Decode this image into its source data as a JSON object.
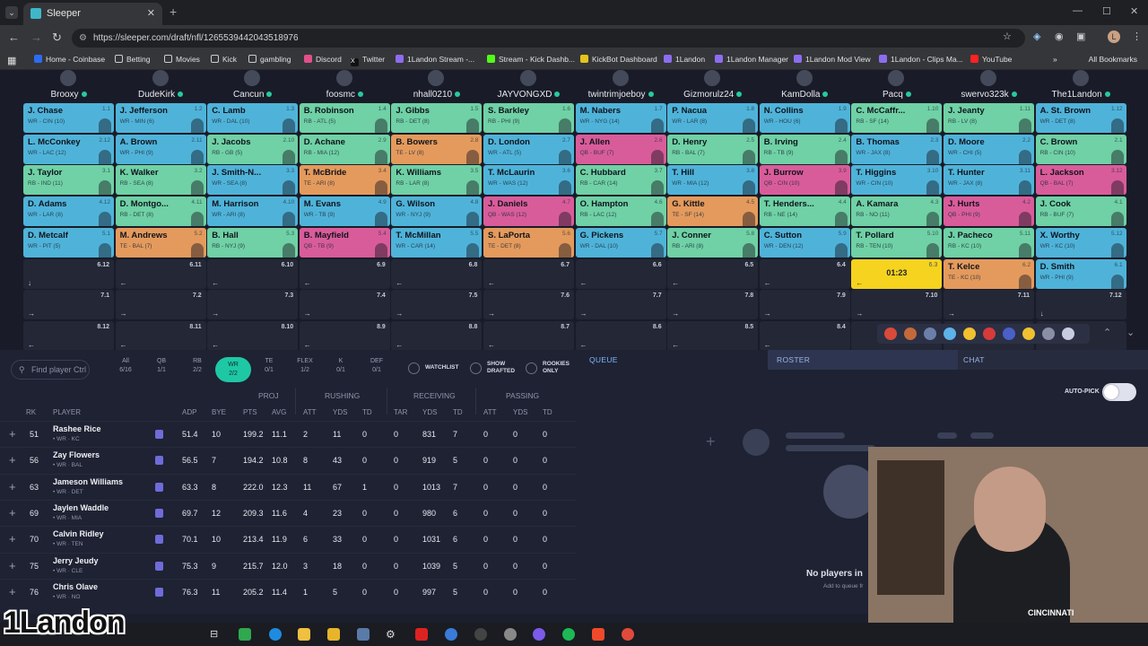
{
  "browser": {
    "tab_title": "Sleeper",
    "url": "https://sleeper.com/draft/nfl/1265539442043518976",
    "bookmarks": [
      "Home - Coinbase",
      "Betting",
      "Movies",
      "Kick",
      "gambling",
      "Discord",
      "Twitter",
      "1Landon Stream -...",
      "Stream - Kick Dashb...",
      "KickBot Dashboard",
      "1Landon",
      "1Landon Manager",
      "1Landon Mod View",
      "1Landon - Clips Ma...",
      "YouTube"
    ],
    "all_bookmarks": "All Bookmarks",
    "profile_initial": "L"
  },
  "teams": [
    "Brooxy",
    "DudeKirk",
    "Cancun",
    "foosmc",
    "nhall0210",
    "JAYVONGXD",
    "twintrimjoeboy",
    "Gizmorulz24",
    "KamDolla",
    "Pacq",
    "swervo323k",
    "The1Landon"
  ],
  "board": [
    [
      {
        "name": "J. Chase",
        "info": "WR - CIN (10)",
        "pick": "1.1",
        "pos": "WR"
      },
      {
        "name": "J. Jefferson",
        "info": "WR - MIN (6)",
        "pick": "1.2",
        "pos": "WR"
      },
      {
        "name": "C. Lamb",
        "info": "WR - DAL (10)",
        "pick": "1.3",
        "pos": "WR"
      },
      {
        "name": "B. Robinson",
        "info": "RB - ATL (5)",
        "pick": "1.4",
        "pos": "RB"
      },
      {
        "name": "J. Gibbs",
        "info": "RB - DET (8)",
        "pick": "1.5",
        "pos": "RB"
      },
      {
        "name": "S. Barkley",
        "info": "RB - PHI (9)",
        "pick": "1.6",
        "pos": "RB"
      },
      {
        "name": "M. Nabers",
        "info": "WR - NYG (14)",
        "pick": "1.7",
        "pos": "WR"
      },
      {
        "name": "P. Nacua",
        "info": "WR - LAR (8)",
        "pick": "1.8",
        "pos": "WR"
      },
      {
        "name": "N. Collins",
        "info": "WR - HOU (6)",
        "pick": "1.9",
        "pos": "WR"
      },
      {
        "name": "C. McCaffr...",
        "info": "RB - SF (14)",
        "pick": "1.10",
        "pos": "RB"
      },
      {
        "name": "J. Jeanty",
        "info": "RB - LV (8)",
        "pick": "1.11",
        "pos": "RB"
      },
      {
        "name": "A. St. Brown",
        "info": "WR - DET (8)",
        "pick": "1.12",
        "pos": "WR"
      }
    ],
    [
      {
        "name": "L. McConkey",
        "info": "WR - LAC (12)",
        "pick": "2.12",
        "pos": "WR"
      },
      {
        "name": "A. Brown",
        "info": "WR - PHI (9)",
        "pick": "2.11",
        "pos": "WR"
      },
      {
        "name": "J. Jacobs",
        "info": "RB - GB (5)",
        "pick": "2.10",
        "pos": "RB"
      },
      {
        "name": "D. Achane",
        "info": "RB - MIA (12)",
        "pick": "2.9",
        "pos": "RB"
      },
      {
        "name": "B. Bowers",
        "info": "TE - LV (8)",
        "pick": "2.8",
        "pos": "TE"
      },
      {
        "name": "D. London",
        "info": "WR - ATL (5)",
        "pick": "2.7",
        "pos": "WR"
      },
      {
        "name": "J. Allen",
        "info": "QB - BUF (7)",
        "pick": "2.6",
        "pos": "QB"
      },
      {
        "name": "D. Henry",
        "info": "RB - BAL (7)",
        "pick": "2.5",
        "pos": "RB"
      },
      {
        "name": "B. Irving",
        "info": "RB - TB (9)",
        "pick": "2.4",
        "pos": "RB"
      },
      {
        "name": "B. Thomas",
        "info": "WR - JAX (8)",
        "pick": "2.3",
        "pos": "WR"
      },
      {
        "name": "D. Moore",
        "info": "WR - CHI (5)",
        "pick": "2.2",
        "pos": "WR"
      },
      {
        "name": "C. Brown",
        "info": "RB - CIN (10)",
        "pick": "2.1",
        "pos": "RB"
      }
    ],
    [
      {
        "name": "J. Taylor",
        "info": "RB - IND (11)",
        "pick": "3.1",
        "pos": "RB"
      },
      {
        "name": "K. Walker",
        "info": "RB - SEA (8)",
        "pick": "3.2",
        "pos": "RB"
      },
      {
        "name": "J. Smith-N...",
        "info": "WR - SEA (8)",
        "pick": "3.3",
        "pos": "WR"
      },
      {
        "name": "T. McBride",
        "info": "TE - ARI (8)",
        "pick": "3.4",
        "pos": "TE"
      },
      {
        "name": "K. Williams",
        "info": "RB - LAR (8)",
        "pick": "3.5",
        "pos": "RB"
      },
      {
        "name": "T. McLaurin",
        "info": "WR - WAS (12)",
        "pick": "3.6",
        "pos": "WR"
      },
      {
        "name": "C. Hubbard",
        "info": "RB - CAR (14)",
        "pick": "3.7",
        "pos": "RB"
      },
      {
        "name": "T. Hill",
        "info": "WR - MIA (12)",
        "pick": "3.8",
        "pos": "WR"
      },
      {
        "name": "J. Burrow",
        "info": "QB - CIN (10)",
        "pick": "3.9",
        "pos": "QB"
      },
      {
        "name": "T. Higgins",
        "info": "WR - CIN (10)",
        "pick": "3.10",
        "pos": "WR"
      },
      {
        "name": "T. Hunter",
        "info": "WR - JAX (8)",
        "pick": "3.11",
        "pos": "WR"
      },
      {
        "name": "L. Jackson",
        "info": "QB - BAL (7)",
        "pick": "3.12",
        "pos": "QB"
      }
    ],
    [
      {
        "name": "D. Adams",
        "info": "WR - LAR (8)",
        "pick": "4.12",
        "pos": "WR"
      },
      {
        "name": "D. Montgo...",
        "info": "RB - DET (8)",
        "pick": "4.11",
        "pos": "RB"
      },
      {
        "name": "M. Harrison",
        "info": "WR - ARI (8)",
        "pick": "4.10",
        "pos": "WR"
      },
      {
        "name": "M. Evans",
        "info": "WR - TB (9)",
        "pick": "4.9",
        "pos": "WR"
      },
      {
        "name": "G. Wilson",
        "info": "WR - NYJ (9)",
        "pick": "4.8",
        "pos": "WR"
      },
      {
        "name": "J. Daniels",
        "info": "QB - WAS (12)",
        "pick": "4.7",
        "pos": "QB"
      },
      {
        "name": "O. Hampton",
        "info": "RB - LAC (12)",
        "pick": "4.6",
        "pos": "RB"
      },
      {
        "name": "G. Kittle",
        "info": "TE - SF (14)",
        "pick": "4.5",
        "pos": "TE"
      },
      {
        "name": "T. Henders...",
        "info": "RB - NE (14)",
        "pick": "4.4",
        "pos": "RB"
      },
      {
        "name": "A. Kamara",
        "info": "RB - NO (11)",
        "pick": "4.3",
        "pos": "RB"
      },
      {
        "name": "J. Hurts",
        "info": "QB - PHI (9)",
        "pick": "4.2",
        "pos": "QB"
      },
      {
        "name": "J. Cook",
        "info": "RB - BUF (7)",
        "pick": "4.1",
        "pos": "RB"
      }
    ],
    [
      {
        "name": "D. Metcalf",
        "info": "WR - PIT (5)",
        "pick": "5.1",
        "pos": "WR"
      },
      {
        "name": "M. Andrews",
        "info": "TE - BAL (7)",
        "pick": "5.2",
        "pos": "TE"
      },
      {
        "name": "B. Hall",
        "info": "RB - NYJ (9)",
        "pick": "5.3",
        "pos": "RB"
      },
      {
        "name": "B. Mayfield",
        "info": "QB - TB (9)",
        "pick": "5.4",
        "pos": "QB"
      },
      {
        "name": "T. McMillan",
        "info": "WR - CAR (14)",
        "pick": "5.5",
        "pos": "WR"
      },
      {
        "name": "S. LaPorta",
        "info": "TE - DET (8)",
        "pick": "5.6",
        "pos": "TE"
      },
      {
        "name": "G. Pickens",
        "info": "WR - DAL (10)",
        "pick": "5.7",
        "pos": "WR"
      },
      {
        "name": "J. Conner",
        "info": "RB - ARI (8)",
        "pick": "5.8",
        "pos": "RB"
      },
      {
        "name": "C. Sutton",
        "info": "WR - DEN (12)",
        "pick": "5.9",
        "pos": "WR"
      },
      {
        "name": "T. Pollard",
        "info": "RB - TEN (10)",
        "pick": "5.10",
        "pos": "RB"
      },
      {
        "name": "J. Pacheco",
        "info": "RB - KC (10)",
        "pick": "5.11",
        "pos": "RB"
      },
      {
        "name": "X. Worthy",
        "info": "WR - KC (10)",
        "pick": "5.12",
        "pos": "WR"
      }
    ],
    [
      {
        "pick": "6.12",
        "arrow": "↓"
      },
      {
        "pick": "6.11",
        "arrow": "←"
      },
      {
        "pick": "6.10",
        "arrow": "←"
      },
      {
        "pick": "6.9",
        "arrow": "←"
      },
      {
        "pick": "6.8",
        "arrow": "←"
      },
      {
        "pick": "6.7",
        "arrow": "←"
      },
      {
        "pick": "6.6",
        "arrow": "←"
      },
      {
        "pick": "6.5",
        "arrow": "←"
      },
      {
        "pick": "6.4",
        "arrow": "←"
      },
      {
        "timer": "01:23",
        "pick": "6.3",
        "arrow": "←"
      },
      {
        "name": "T. Kelce",
        "info": "TE - KC (10)",
        "pick": "6.2",
        "pos": "TE"
      },
      {
        "name": "D. Smith",
        "info": "WR - PHI (9)",
        "pick": "6.1",
        "pos": "WR"
      }
    ],
    [
      {
        "pick": "7.1",
        "arrow": "→"
      },
      {
        "pick": "7.2",
        "arrow": "→"
      },
      {
        "pick": "7.3",
        "arrow": "→"
      },
      {
        "pick": "7.4",
        "arrow": "→"
      },
      {
        "pick": "7.5",
        "arrow": "→"
      },
      {
        "pick": "7.6",
        "arrow": "→"
      },
      {
        "pick": "7.7",
        "arrow": "→"
      },
      {
        "pick": "7.8",
        "arrow": "→"
      },
      {
        "pick": "7.9",
        "arrow": "→"
      },
      {
        "pick": "7.10",
        "arrow": "→"
      },
      {
        "pick": "7.11",
        "arrow": "→"
      },
      {
        "pick": "7.12",
        "arrow": "↓"
      }
    ],
    [
      {
        "pick": "8.12",
        "arrow": "←"
      },
      {
        "pick": "8.11",
        "arrow": "←"
      },
      {
        "pick": "8.10",
        "arrow": "←"
      },
      {
        "pick": "8.9",
        "arrow": "←"
      },
      {
        "pick": "8.8",
        "arrow": "←"
      },
      {
        "pick": "8.7",
        "arrow": "←"
      },
      {
        "pick": "8.6",
        "arrow": "←"
      },
      {
        "pick": "8.5",
        "arrow": "←"
      },
      {
        "pick": "8.4",
        "arrow": "←"
      },
      {
        "pick": "",
        "arrow": ""
      },
      {
        "pick": "",
        "arrow": ""
      },
      {
        "pick": "",
        "arrow": ""
      }
    ]
  ],
  "position_colors": {
    "WR": "#4fb3d9",
    "RB": "#6fd1a5",
    "TE": "#e49a5c",
    "QB": "#d95c9a"
  },
  "panel": {
    "search_placeholder": "Find player Ctrl",
    "filters": [
      {
        "label": "All",
        "count": "6/16"
      },
      {
        "label": "QB",
        "count": "1/1"
      },
      {
        "label": "RB",
        "count": "2/2"
      },
      {
        "label": "WR",
        "count": "2/2",
        "active": true
      },
      {
        "label": "TE",
        "count": "0/1"
      },
      {
        "label": "FLEX",
        "count": "1/2"
      },
      {
        "label": "K",
        "count": "0/1"
      },
      {
        "label": "DEF",
        "count": "0/1"
      }
    ],
    "watchlist": "WATCHLIST",
    "show_drafted": "SHOW DRAFTED",
    "rookies_only": "ROOKIES ONLY",
    "groups": {
      "proj": "PROJ",
      "rushing": "RUSHING",
      "receiving": "RECEIVING",
      "passing": "PASSING"
    },
    "headers": {
      "rk": "RK",
      "player": "PLAYER",
      "adp": "ADP",
      "bye": "BYE",
      "pts": "PTS",
      "avg": "AVG",
      "att": "ATT",
      "yds": "YDS",
      "td": "TD",
      "tar": "TAR",
      "ryds": "YDS",
      "rtd": "TD",
      "patt": "ATT",
      "pyds": "YDS",
      "ptd": "TD"
    },
    "players": [
      {
        "rk": "51",
        "name": "Rashee Rice",
        "sub": "• WR · KC",
        "adp": "51.4",
        "bye": "10",
        "pts": "199.2",
        "avg": "11.1",
        "att": "2",
        "yds": "11",
        "td": "0",
        "tar": "0",
        "ryds": "831",
        "rtd": "7",
        "patt": "0",
        "pyds": "0",
        "ptd": "0"
      },
      {
        "rk": "56",
        "name": "Zay Flowers",
        "sub": "• WR · BAL",
        "adp": "56.5",
        "bye": "7",
        "pts": "194.2",
        "avg": "10.8",
        "att": "8",
        "yds": "43",
        "td": "0",
        "tar": "0",
        "ryds": "919",
        "rtd": "5",
        "patt": "0",
        "pyds": "0",
        "ptd": "0"
      },
      {
        "rk": "63",
        "name": "Jameson Williams",
        "sub": "• WR · DET",
        "adp": "63.3",
        "bye": "8",
        "pts": "222.0",
        "avg": "12.3",
        "att": "11",
        "yds": "67",
        "td": "1",
        "tar": "0",
        "ryds": "1013",
        "rtd": "7",
        "patt": "0",
        "pyds": "0",
        "ptd": "0"
      },
      {
        "rk": "69",
        "name": "Jaylen Waddle",
        "sub": "• WR · MIA",
        "adp": "69.7",
        "bye": "12",
        "pts": "209.3",
        "avg": "11.6",
        "att": "4",
        "yds": "23",
        "td": "0",
        "tar": "0",
        "ryds": "980",
        "rtd": "6",
        "patt": "0",
        "pyds": "0",
        "ptd": "0"
      },
      {
        "rk": "70",
        "name": "Calvin Ridley",
        "sub": "• WR · TEN",
        "adp": "70.1",
        "bye": "10",
        "pts": "213.4",
        "avg": "11.9",
        "att": "6",
        "yds": "33",
        "td": "0",
        "tar": "0",
        "ryds": "1031",
        "rtd": "6",
        "patt": "0",
        "pyds": "0",
        "ptd": "0"
      },
      {
        "rk": "75",
        "name": "Jerry Jeudy",
        "sub": "• WR · CLE",
        "adp": "75.3",
        "bye": "9",
        "pts": "215.7",
        "avg": "12.0",
        "att": "3",
        "yds": "18",
        "td": "0",
        "tar": "0",
        "ryds": "1039",
        "rtd": "5",
        "patt": "0",
        "pyds": "0",
        "ptd": "0"
      },
      {
        "rk": "76",
        "name": "Chris Olave",
        "sub": "• WR · NO",
        "adp": "76.3",
        "bye": "11",
        "pts": "205.2",
        "avg": "11.4",
        "att": "1",
        "yds": "5",
        "td": "0",
        "tar": "0",
        "ryds": "997",
        "rtd": "5",
        "patt": "0",
        "pyds": "0",
        "ptd": "0"
      }
    ],
    "queue": "QUEUE",
    "roster": "ROSTER",
    "chat": "CHAT",
    "auto_pick": "AUTO-PICK",
    "no_players": "No players in",
    "add_to_queue": "Add to queue fr"
  },
  "stream": {
    "cam_text": "CINCINNATI",
    "logo": "1Landon"
  }
}
